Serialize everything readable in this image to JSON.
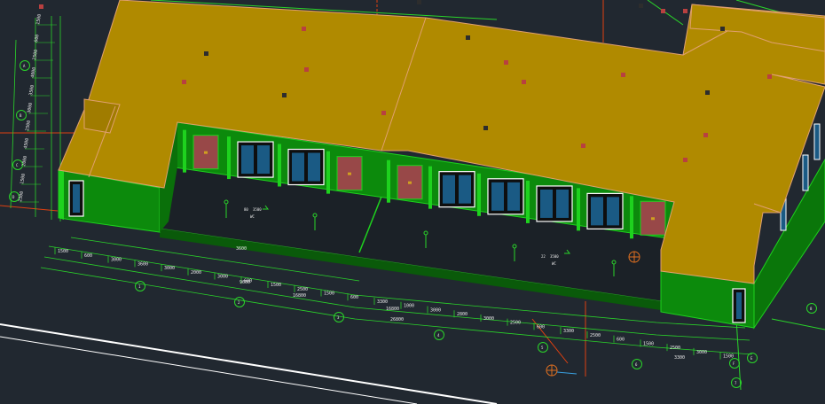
{
  "app": {
    "name": "AutoCAD 3D Viewport"
  },
  "colors": {
    "background": "#212830",
    "roof": "#b08a00",
    "roof_edge": "#e0a070",
    "wall_green": "#0c8a0c",
    "wall_light": "#1ed21e",
    "grid_green": "#2ad52a",
    "axis_red": "#e04010",
    "window_glass": "#1a5a84",
    "door": "#984848",
    "dim_text": "#e9e9e9"
  },
  "dimension_labels": {
    "bottom_row": [
      "1500",
      "600",
      "3000",
      "3600",
      "3000",
      "2000",
      "3000",
      "600",
      "1500",
      "2500",
      "1500",
      "600",
      "3300",
      "1000",
      "3000",
      "2800",
      "3000",
      "2500",
      "600",
      "3300",
      "2500",
      "600",
      "1500",
      "2500",
      "3000",
      "1500"
    ],
    "bottom_totals": [
      "3600",
      "9600",
      "16800",
      "16800",
      "26800",
      "3300"
    ],
    "left_column": [
      "1500",
      "600",
      "2500",
      "4000",
      "3500",
      "3000",
      "2500",
      "4500",
      "2000",
      "1500",
      "2500"
    ],
    "courtyard": [
      "80",
      "3500",
      "22",
      "3500"
    ]
  },
  "grid_bubbles": [
    "1",
    "2",
    "3",
    "4",
    "5",
    "6",
    "7",
    "8",
    "A",
    "B",
    "C",
    "D",
    "E",
    "F"
  ],
  "name_tags": [
    "WC",
    "WC"
  ]
}
